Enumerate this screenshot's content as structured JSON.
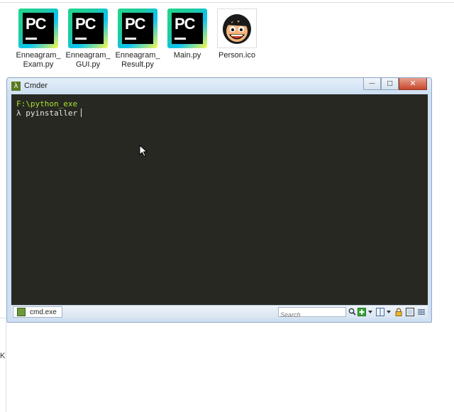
{
  "desktop": {
    "icons": [
      {
        "label": "Enneagram_\nExam.py",
        "line1": "Enneagram_",
        "line2": "Exam.py",
        "glyph": "PC"
      },
      {
        "label": "Enneagram_\nGUI.py",
        "line1": "Enneagram_",
        "line2": "GUI.py",
        "glyph": "PC"
      },
      {
        "label": "Enneagram_\nResult.py",
        "line1": "Enneagram_",
        "line2": "Result.py",
        "glyph": "PC"
      },
      {
        "label": "Main.py",
        "line1": "Main.py",
        "line2": "",
        "glyph": "PC"
      },
      {
        "label": "Person.ico",
        "line1": "Person.ico",
        "line2": ""
      }
    ]
  },
  "background": {
    "stray_text": "K"
  },
  "window": {
    "title": "Cmder",
    "app_glyph": "λ",
    "buttons": {
      "minimize": "—",
      "maximize": "□",
      "close": "✕"
    }
  },
  "terminal": {
    "path": "F:\\python_exe",
    "prompt_symbol": "λ",
    "command": "pyinstaller"
  },
  "statusbar": {
    "tab_label": "cmd.exe",
    "search_placeholder": "Search"
  },
  "colors": {
    "terminal_bg": "#272822",
    "path_green": "#a6e22e",
    "text": "#e8e8e2",
    "titlebar": "#cfe0f2"
  }
}
